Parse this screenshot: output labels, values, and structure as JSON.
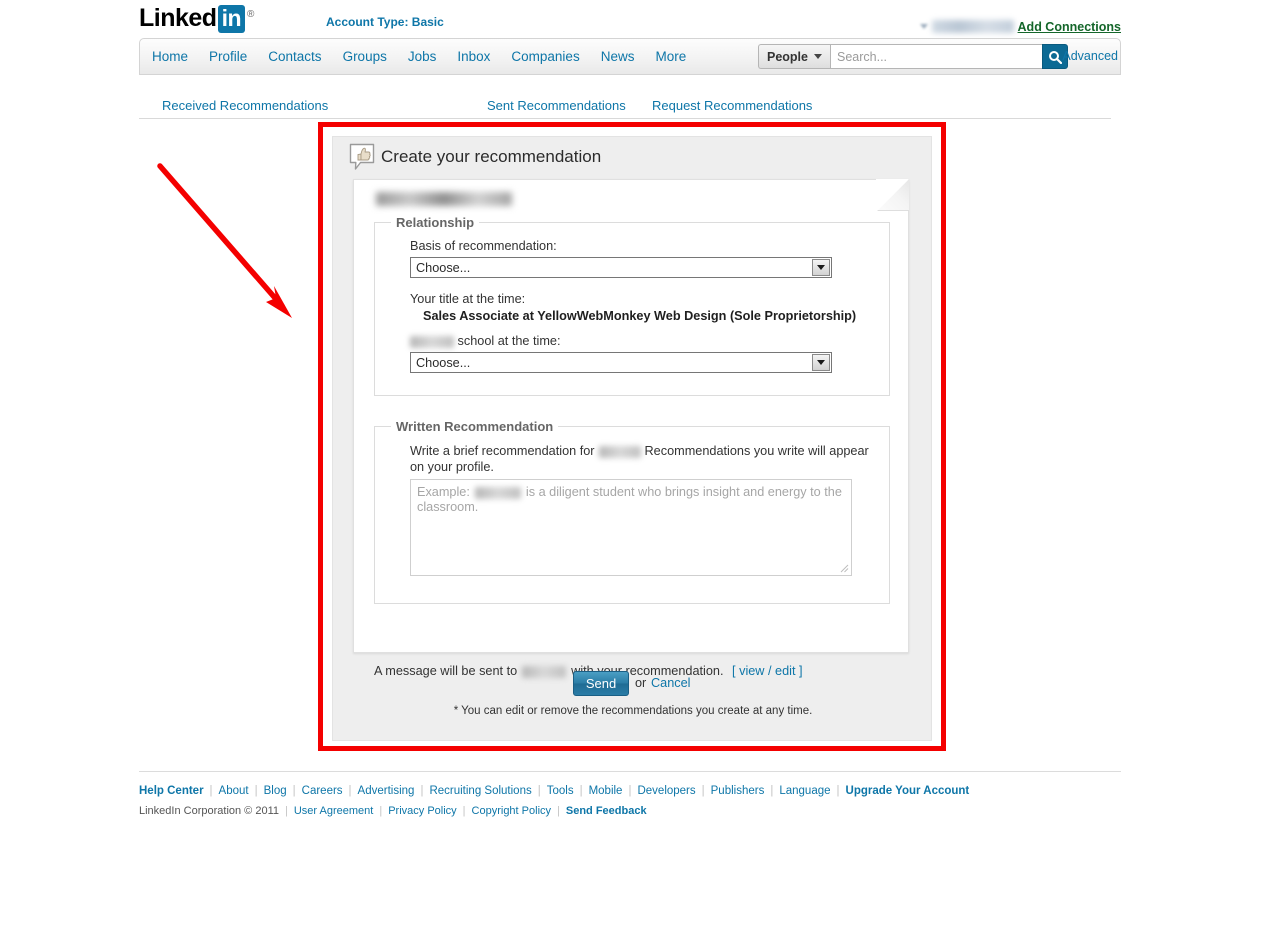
{
  "header": {
    "logo_text": "Linked",
    "logo_badge": "in",
    "logo_reg": "®",
    "account_type": "Account Type: Basic",
    "add_connections": "Add Connections",
    "user_name_redacted": ""
  },
  "nav": {
    "items": [
      {
        "label": "Home",
        "name": "nav-home"
      },
      {
        "label": "Profile",
        "name": "nav-profile"
      },
      {
        "label": "Contacts",
        "name": "nav-contacts"
      },
      {
        "label": "Groups",
        "name": "nav-groups"
      },
      {
        "label": "Jobs",
        "name": "nav-jobs"
      },
      {
        "label": "Inbox",
        "name": "nav-inbox"
      },
      {
        "label": "Companies",
        "name": "nav-companies"
      },
      {
        "label": "News",
        "name": "nav-news"
      },
      {
        "label": "More",
        "name": "nav-more"
      }
    ],
    "search_scope": "People",
    "search_placeholder": "Search...",
    "search_value": "",
    "advanced": "Advanced",
    "search_icon": "magnifier-icon"
  },
  "subtabs": [
    {
      "label": "Received Recommendations"
    },
    {
      "label": "Sent Recommendations"
    },
    {
      "label": "Request Recommendations"
    }
  ],
  "panel": {
    "icon": "thumbs-up-bubble-icon",
    "title": "Create your recommendation",
    "recipient_name_redacted": "",
    "relationship": {
      "legend": "Relationship",
      "basis_label": "Basis of recommendation:",
      "basis_value": "Choose...",
      "title_label": "Your title at the time:",
      "title_value": "Sales Associate at YellowWebMonkey Web Design (Sole Proprietorship)",
      "school_label_suffix": "school at the time:",
      "school_value": "Choose..."
    },
    "written": {
      "legend": "Written Recommendation",
      "intro_before": "Write a brief recommendation for",
      "intro_after": "Recommendations you write will appear on your profile.",
      "textarea_placeholder_before": "Example:",
      "textarea_placeholder_after": "is a diligent student who brings insight and energy to the classroom.",
      "textarea_value": ""
    },
    "message_before": "A message will be sent to",
    "message_after": "with your recommendation.",
    "view_edit_open": "[",
    "view_edit": "view / edit",
    "view_edit_close": "]",
    "send_label": "Send",
    "or_label": "or",
    "cancel_label": "Cancel",
    "note": "* You can edit or remove the recommendations you create at any time."
  },
  "footer": {
    "links_primary": [
      {
        "label": "Help Center",
        "bold": true
      },
      {
        "label": "About",
        "bold": false
      },
      {
        "label": "Blog",
        "bold": false
      },
      {
        "label": "Careers",
        "bold": false
      },
      {
        "label": "Advertising",
        "bold": false
      },
      {
        "label": "Recruiting Solutions",
        "bold": false
      },
      {
        "label": "Tools",
        "bold": false
      },
      {
        "label": "Mobile",
        "bold": false
      },
      {
        "label": "Developers",
        "bold": false
      },
      {
        "label": "Publishers",
        "bold": false
      },
      {
        "label": "Language",
        "bold": false
      },
      {
        "label": "Upgrade Your Account",
        "bold": true
      }
    ],
    "copyright": "LinkedIn Corporation © 2011",
    "links_secondary": [
      {
        "label": "User Agreement",
        "bold": false
      },
      {
        "label": "Privacy Policy",
        "bold": false
      },
      {
        "label": "Copyright Policy",
        "bold": false
      },
      {
        "label": "Send Feedback",
        "bold": true
      }
    ]
  },
  "annotation": {
    "box_color": "#f40000",
    "arrow_color": "#f40000"
  }
}
